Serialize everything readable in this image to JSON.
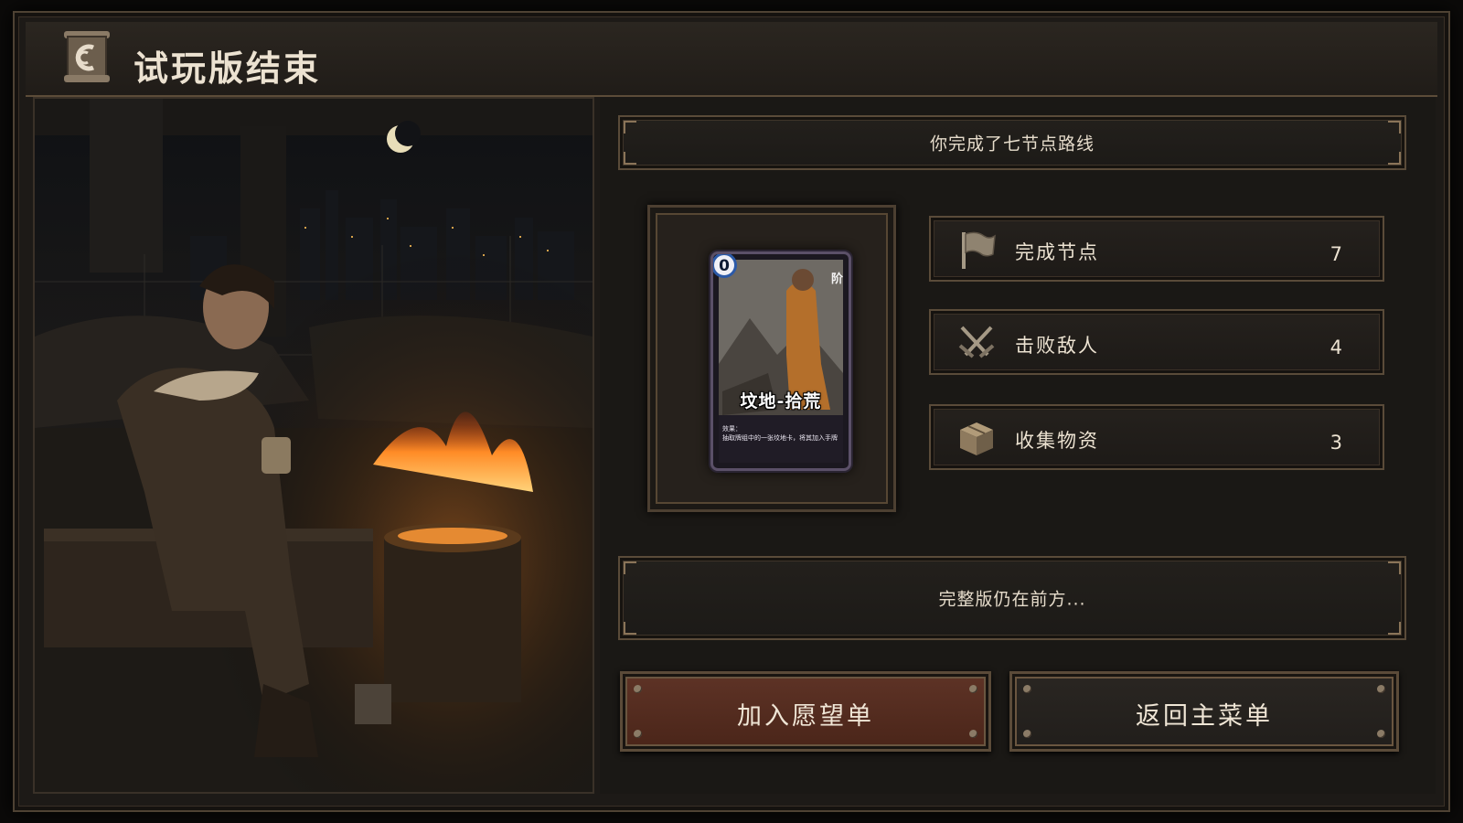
{
  "window": {
    "title": "试玩版结束",
    "emblem_icon": "scroll-emblem-icon"
  },
  "summary_banner": {
    "text": "你完成了七节点路线"
  },
  "card": {
    "cost": "0",
    "rank": "阶",
    "name": "坟地-拾荒",
    "effect_label": "效果：",
    "effect_text": "抽取牌组中的一张坟地卡，将其加入手牌"
  },
  "stats": [
    {
      "icon": "flag-icon",
      "label": "完成节点",
      "value": "7"
    },
    {
      "icon": "crossed-swords-icon",
      "label": "击败敌人",
      "value": "4"
    },
    {
      "icon": "supply-crate-icon",
      "label": "收集物资",
      "value": "3"
    }
  ],
  "message_banner": {
    "text": "完整版仍在前方..."
  },
  "buttons": {
    "wishlist": "加入愿望单",
    "main_menu": "返回主菜单"
  },
  "colors": {
    "accent_button": "#5e3326",
    "panel_border": "#5a4b39",
    "card_cost_ring": "#2c5aa8"
  }
}
